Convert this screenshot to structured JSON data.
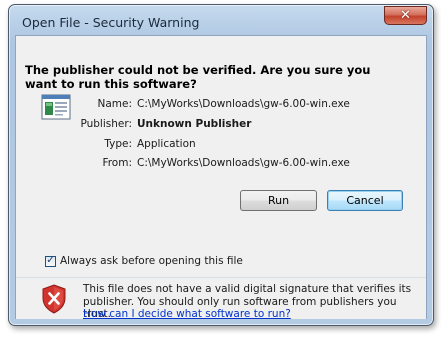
{
  "window": {
    "title": "Open File - Security Warning",
    "close_glyph": "✕"
  },
  "dialog": {
    "headline": "The publisher could not be verified.  Are you sure you want to run this software?",
    "file_icon": "document-icon",
    "fields": {
      "name_label": "Name:",
      "name_value": "C:\\MyWorks\\Downloads\\gw-6.00-win.exe",
      "publisher_label": "Publisher:",
      "publisher_value": "Unknown Publisher",
      "type_label": "Type:",
      "type_value": "Application",
      "from_label": "From:",
      "from_value": "C:\\MyWorks\\Downloads\\gw-6.00-win.exe"
    },
    "buttons": {
      "run_label": "Run",
      "cancel_label": "Cancel"
    },
    "checkbox": {
      "label": "Always ask before opening this file",
      "checked": true,
      "check_glyph": "✓"
    },
    "warning": {
      "icon": "shield-warning-icon",
      "text": "This file does not have a valid digital signature that verifies its publisher.  You should only run software from publishers you trust.",
      "link_text": "How can I decide what software to run?"
    }
  },
  "colors": {
    "frame": "#b4cbe4",
    "client_bg": "#f0f0f0",
    "link": "#0033cc",
    "close_button": "#c3412b",
    "shield_red": "#d0342c"
  }
}
